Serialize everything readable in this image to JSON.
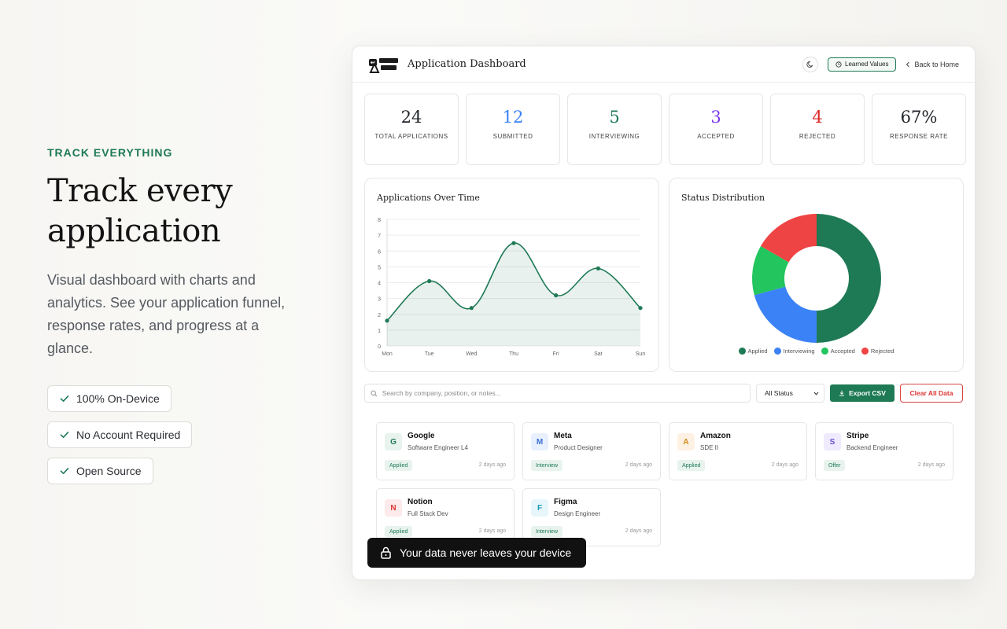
{
  "hero": {
    "eyebrow": "TRACK EVERYTHING",
    "headline_line1": "Track every",
    "headline_line2": "application",
    "description": "Visual dashboard with charts and analytics. See your application funnel, response rates, and progress at a glance.",
    "features": [
      "100% On-Device",
      "No Account Required",
      "Open Source"
    ]
  },
  "dashboard": {
    "title": "Application Dashboard",
    "learned_values_label": "Learned Values",
    "back_label": "Back to Home",
    "stats": [
      {
        "value": "24",
        "label": "TOTAL APPLICATIONS",
        "color": "#1f2328"
      },
      {
        "value": "12",
        "label": "SUBMITTED",
        "color": "#3b82f6"
      },
      {
        "value": "5",
        "label": "INTERVIEWING",
        "color": "#1e7a55"
      },
      {
        "value": "3",
        "label": "ACCEPTED",
        "color": "#7c3aed"
      },
      {
        "value": "4",
        "label": "REJECTED",
        "color": "#dc2626"
      },
      {
        "value": "67%",
        "label": "RESPONSE RATE",
        "color": "#1f2328"
      }
    ],
    "line_chart_title": "Applications Over Time",
    "pie_chart_title": "Status Distribution",
    "search_placeholder": "Search by company, position, or notes...",
    "status_filter": "All Status",
    "export_label": "Export CSV",
    "clear_label": "Clear All Data",
    "applications": [
      {
        "letter": "G",
        "company": "Google",
        "position": "Software Engineer L4",
        "status": "Applied",
        "time": "2 days ago",
        "tint": "#e8f3ee",
        "fg": "#1e7a55"
      },
      {
        "letter": "M",
        "company": "Meta",
        "position": "Product Designer",
        "status": "Interview",
        "time": "2 days ago",
        "tint": "#e8f0fe",
        "fg": "#3b6fd4"
      },
      {
        "letter": "A",
        "company": "Amazon",
        "position": "SDE II",
        "status": "Applied",
        "time": "2 days ago",
        "tint": "#fdf1e3",
        "fg": "#d98a1b"
      },
      {
        "letter": "S",
        "company": "Stripe",
        "position": "Backend Engineer",
        "status": "Offer",
        "time": "2 days ago",
        "tint": "#efeafd",
        "fg": "#6d4fd8"
      },
      {
        "letter": "N",
        "company": "Notion",
        "position": "Full Stack Dev",
        "status": "Applied",
        "time": "2 days ago",
        "tint": "#fdeaea",
        "fg": "#d33"
      },
      {
        "letter": "F",
        "company": "Figma",
        "position": "Design Engineer",
        "status": "Interview",
        "time": "2 days ago",
        "tint": "#e6f6fb",
        "fg": "#1b9ac0"
      }
    ],
    "badge_colors": {
      "Applied": "#e8f3ee",
      "Interview": "#e8f3ee",
      "Offer": "#e8f3ee"
    }
  },
  "toast": {
    "message": "Your data never leaves your device"
  },
  "chart_data": [
    {
      "type": "line",
      "title": "Applications Over Time",
      "x": [
        "Mon",
        "Tue",
        "Wed",
        "Thu",
        "Fri",
        "Sat",
        "Sun"
      ],
      "series": [
        {
          "values": [
            1.6,
            4.1,
            2.4,
            6.5,
            3.2,
            4.9,
            2.4
          ]
        }
      ],
      "ylim": [
        0,
        8
      ],
      "yticks": [
        0,
        1,
        2,
        3,
        4,
        5,
        6,
        7,
        8
      ],
      "grid": true,
      "color": "#1e7a55"
    },
    {
      "type": "pie",
      "title": "Status Distribution",
      "donut": true,
      "categories": [
        "Applied",
        "Interviewing",
        "Accepted",
        "Rejected"
      ],
      "values": [
        12,
        5,
        3,
        4
      ],
      "colors": [
        "#1e7a55",
        "#3b82f6",
        "#22c55e",
        "#ef4444"
      ],
      "legend": "bottom"
    }
  ]
}
